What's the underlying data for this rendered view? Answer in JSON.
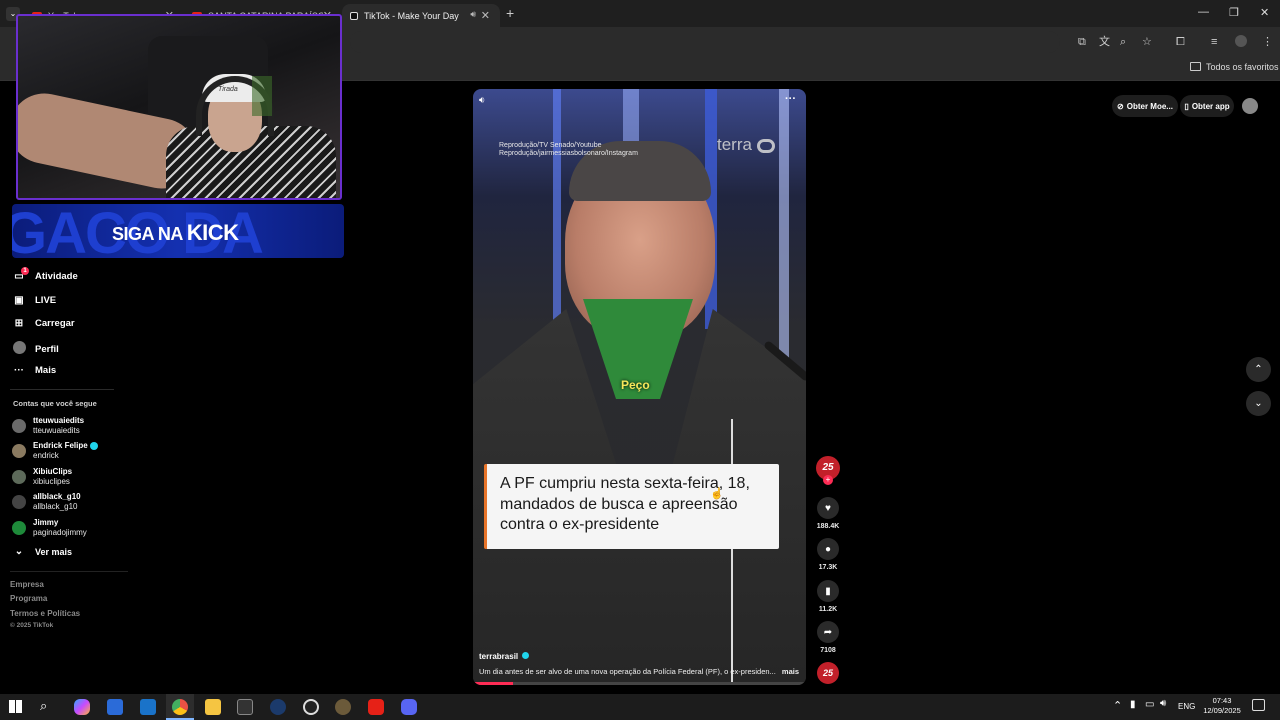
{
  "browser": {
    "tabs": [
      {
        "label": "YouTube",
        "color": "#e62117"
      },
      {
        "label": "SANTA CATARINA PARAÍSO DA...",
        "color": "#e62117"
      },
      {
        "label": "TikTok - Make Your Day",
        "color": "#ffffff"
      }
    ],
    "new_tab_label": "+",
    "bookmarks_label": "Todos os favoritos"
  },
  "overlay": {
    "kick_text_pre": "SIGA NA",
    "kick_text_brand": "KICK",
    "kick_brand_color": "#ffffff",
    "cap_text": "Tirada"
  },
  "sidebar": {
    "items": [
      {
        "label": "Atividade",
        "icon": "inbox-icon",
        "badge": "1"
      },
      {
        "label": "LIVE",
        "icon": "live-icon"
      },
      {
        "label": "Carregar",
        "icon": "upload-icon"
      },
      {
        "label": "Perfil",
        "icon": "profile-avatar-icon"
      },
      {
        "label": "Mais",
        "icon": "more-dots-icon"
      }
    ],
    "following_title": "Contas que você segue",
    "following": [
      {
        "name": "tteuwuaiedits",
        "handle": "tteuwuaiedits",
        "verified": false
      },
      {
        "name": "Endrick Felipe",
        "handle": "endrick",
        "verified": true
      },
      {
        "name": "XibiuClips",
        "handle": "xibiuclipes",
        "verified": false
      },
      {
        "name": "allblack_g10",
        "handle": "allblack_g10",
        "verified": false
      },
      {
        "name": "Jimmy",
        "handle": "paginadojimmy",
        "verified": false
      }
    ],
    "see_more": "Ver mais",
    "footer": [
      "Empresa",
      "Programa",
      "Termos e Políticas",
      "© 2025 TikTok"
    ]
  },
  "topright": {
    "coins": "Obter Moe...",
    "app": "Obter app"
  },
  "video": {
    "credit_1": "Reprodução/TV Senado/Youtube",
    "credit_2": "Reprodução/jairmessiasbolsonaro/Instagram",
    "watermark": "terra",
    "subtitle": "Peço",
    "caption_box": "A PF cumpriu nesta sexta-feira, 18, mandados de busca e apreensão contra o ex-presidente",
    "author": "terrabrasil",
    "description": "Um dia antes de ser alvo de uma nova operação da Polícia Federal (PF), o ex-presiden...",
    "more": "mais",
    "avatar_text": "25"
  },
  "actions": {
    "likes": "188.4K",
    "comments": "17.3K",
    "saves": "11.2K",
    "shares": "7108"
  },
  "taskbar": {
    "lang": "ENG",
    "time": "07:43",
    "date": "12/09/2025"
  }
}
